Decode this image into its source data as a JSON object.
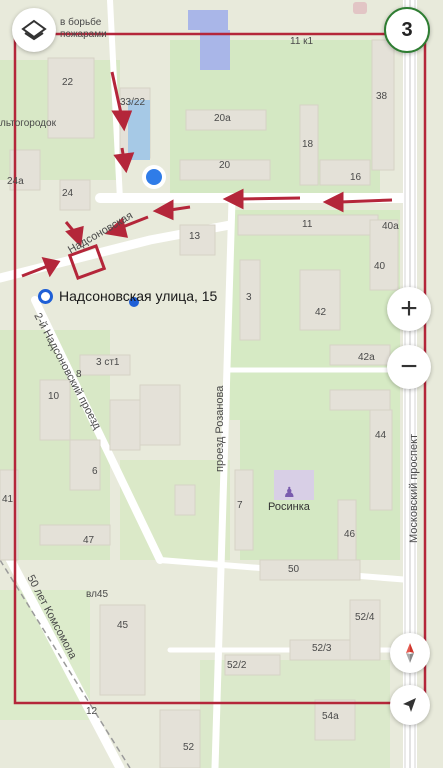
{
  "map": {
    "step_badge": "3",
    "address_label": "Надсоновская улица, 15",
    "poi_label": "Росинка",
    "streets": {
      "nadsonovskaya": "Надсоновская",
      "proezd_2_nadsonovsky": "2-й Надсоновский проезд",
      "proezd_rozanova": "проезд Розанова",
      "moskovsky_prospekt": "Московский проспект",
      "let_komsomola": "50 лет Комсомола"
    },
    "top_labels": {
      "fire_station": "в борьбе",
      "fire_station_2": "пожарами",
      "town": "льтогородок"
    },
    "house_numbers": [
      "22",
      "33/22",
      "20а",
      "11 к1",
      "38",
      "18",
      "20",
      "16",
      "24а",
      "24",
      "13",
      "11",
      "40а",
      "40",
      "3",
      "42",
      "42а",
      "3 ст1",
      "8",
      "10",
      "44",
      "6",
      "46",
      "7",
      "41",
      "47",
      "50",
      "вл45",
      "45",
      "52/2",
      "52/3",
      "52/4",
      "54а",
      "12",
      "52"
    ]
  },
  "controls": {
    "zoom_in": "+",
    "zoom_out": "−"
  },
  "colors": {
    "route_red": "#b4263a",
    "park_green": "#cfe6b7",
    "building": "#e4e1d8",
    "road": "#ffffff",
    "accent_blue": "#1e5fd6"
  }
}
